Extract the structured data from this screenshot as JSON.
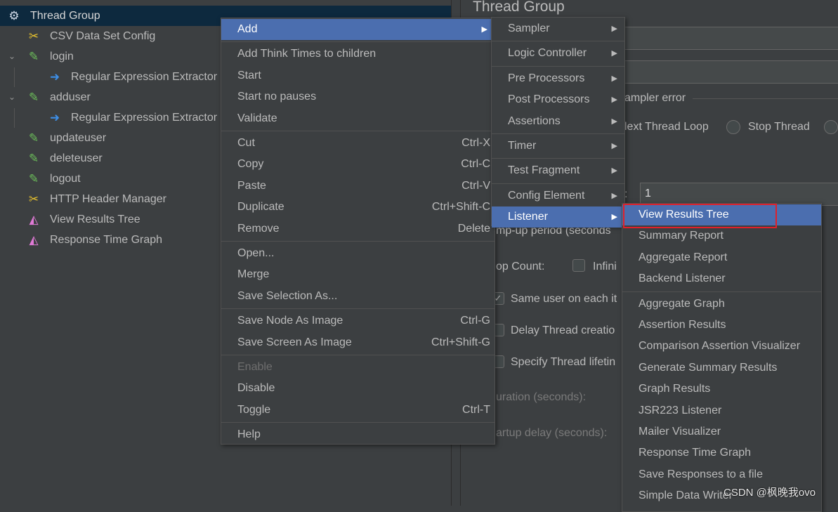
{
  "tree": {
    "items": [
      {
        "label": "Thread Group",
        "icon": "gear-icon"
      },
      {
        "label": "CSV Data Set Config",
        "icon": "wrench-screwdriver-icon"
      },
      {
        "label": "login",
        "icon": "pipette-icon"
      },
      {
        "label": "Regular Expression Extractor",
        "icon": "extractor-icon"
      },
      {
        "label": "adduser",
        "icon": "pipette-icon"
      },
      {
        "label": "Regular Expression Extractor",
        "icon": "extractor-icon"
      },
      {
        "label": "updateuser",
        "icon": "pipette-icon"
      },
      {
        "label": "deleteuser",
        "icon": "pipette-icon"
      },
      {
        "label": "logout",
        "icon": "pipette-icon"
      },
      {
        "label": "HTTP Header Manager",
        "icon": "wrench-screwdriver-icon"
      },
      {
        "label": "View Results Tree",
        "icon": "listener-graph-icon"
      },
      {
        "label": "Response Time Graph",
        "icon": "listener-graph-icon"
      }
    ]
  },
  "panel": {
    "title": "Thread Group",
    "sampler_error": "ampler error",
    "next_loop": "lext Thread Loop",
    "stop_thread": "Stop Thread",
    "threads_value": "1",
    "threads_colon": ":",
    "rampup": "mp-up period (seconds",
    "loop_count": "op Count:",
    "infinite": "Infini",
    "same_user": "Same user on each it",
    "delay": "Delay Thread creatio",
    "lifetime": "Specify Thread lifetin",
    "duration": "uration (seconds):",
    "startup": "artup delay (seconds):"
  },
  "context_menu": {
    "items": [
      {
        "label": "Add",
        "submenu": true,
        "highlighted": true
      },
      {
        "sep": true
      },
      {
        "label": "Add Think Times to children"
      },
      {
        "label": "Start"
      },
      {
        "label": "Start no pauses"
      },
      {
        "label": "Validate"
      },
      {
        "sep": true
      },
      {
        "label": "Cut",
        "shortcut": "Ctrl-X"
      },
      {
        "label": "Copy",
        "shortcut": "Ctrl-C"
      },
      {
        "label": "Paste",
        "shortcut": "Ctrl-V"
      },
      {
        "label": "Duplicate",
        "shortcut": "Ctrl+Shift-C"
      },
      {
        "label": "Remove",
        "shortcut": "Delete"
      },
      {
        "sep": true
      },
      {
        "label": "Open..."
      },
      {
        "label": "Merge"
      },
      {
        "label": "Save Selection As..."
      },
      {
        "sep": true
      },
      {
        "label": "Save Node As Image",
        "shortcut": "Ctrl-G"
      },
      {
        "label": "Save Screen As Image",
        "shortcut": "Ctrl+Shift-G"
      },
      {
        "sep": true
      },
      {
        "label": "Enable",
        "disabled": true
      },
      {
        "label": "Disable"
      },
      {
        "label": "Toggle",
        "shortcut": "Ctrl-T"
      },
      {
        "sep": true
      },
      {
        "label": "Help"
      }
    ]
  },
  "add_menu": {
    "items": [
      {
        "label": "Sampler",
        "submenu": true
      },
      {
        "sep": true
      },
      {
        "label": "Logic Controller",
        "submenu": true
      },
      {
        "sep": true
      },
      {
        "label": "Pre Processors",
        "submenu": true
      },
      {
        "label": "Post Processors",
        "submenu": true
      },
      {
        "label": "Assertions",
        "submenu": true
      },
      {
        "sep": true
      },
      {
        "label": "Timer",
        "submenu": true
      },
      {
        "sep": true
      },
      {
        "label": "Test Fragment",
        "submenu": true
      },
      {
        "sep": true
      },
      {
        "label": "Config Element",
        "submenu": true
      },
      {
        "label": "Listener",
        "submenu": true,
        "highlighted": true
      }
    ]
  },
  "listener_menu": {
    "items": [
      {
        "label": "View Results Tree",
        "highlighted": true
      },
      {
        "label": "Summary Report"
      },
      {
        "label": "Aggregate Report"
      },
      {
        "label": "Backend Listener"
      },
      {
        "sep": true
      },
      {
        "label": "Aggregate Graph"
      },
      {
        "label": "Assertion Results"
      },
      {
        "label": "Comparison Assertion Visualizer"
      },
      {
        "label": "Generate Summary Results"
      },
      {
        "label": "Graph Results"
      },
      {
        "label": "JSR223 Listener"
      },
      {
        "label": "Mailer Visualizer"
      },
      {
        "label": "Response Time Graph"
      },
      {
        "label": "Save Responses to a file"
      },
      {
        "label": "Simple Data Writer"
      }
    ]
  },
  "watermark": "CSDN @枫晚我ovo",
  "colors": {
    "highlight": "#4b6eaf",
    "selection": "#0d293e",
    "annotation": "#e0202a",
    "background": "#3c3f41"
  }
}
